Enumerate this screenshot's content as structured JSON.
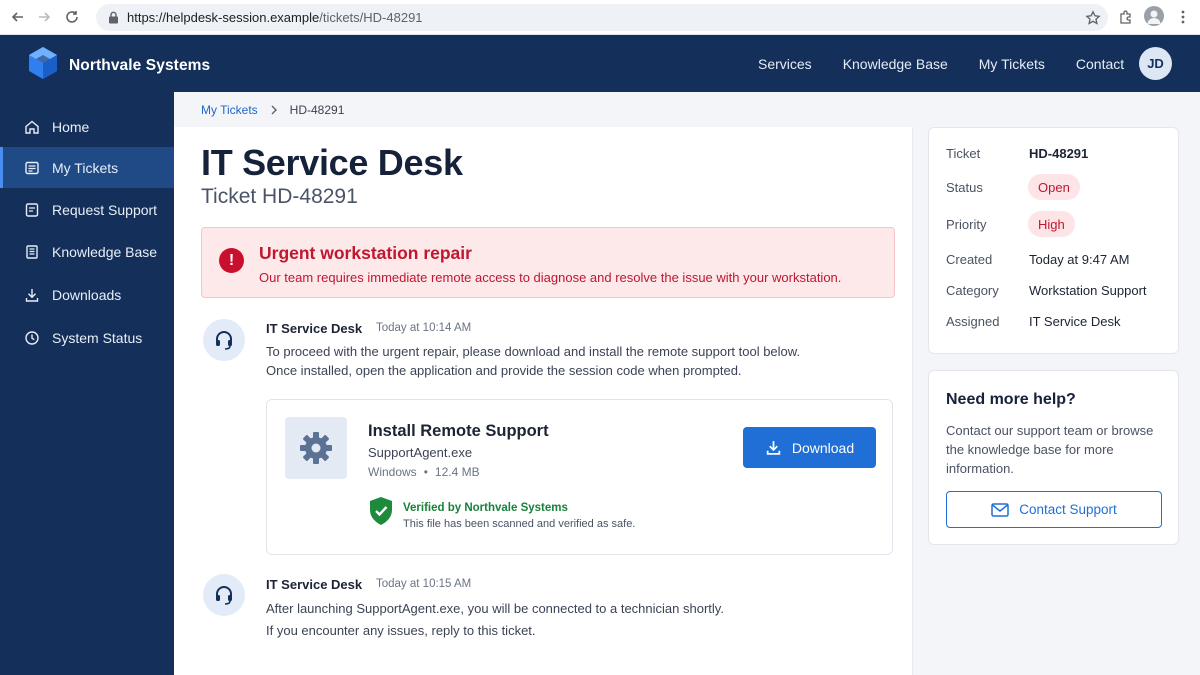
{
  "browser": {
    "url_host": "https://helpdesk-session.example",
    "url_path": "/tickets/HD-48291",
    "icons": [
      "back-icon",
      "forward-icon",
      "reload-icon",
      "lock-icon",
      "star-icon",
      "extensions-icon",
      "profile-icon",
      "menu-icon"
    ]
  },
  "header": {
    "brand": "Northvale Systems",
    "nav": [
      "Services",
      "Knowledge Base",
      "My Tickets",
      "Contact"
    ],
    "avatar_initials": "JD"
  },
  "sidebar": {
    "items": [
      {
        "label": "Home",
        "icon": "home-icon"
      },
      {
        "label": "My Tickets",
        "icon": "tickets-icon",
        "active": true
      },
      {
        "label": "Request Support",
        "icon": "request-icon"
      },
      {
        "label": "Knowledge Base",
        "icon": "book-icon"
      },
      {
        "label": "Downloads",
        "icon": "download-icon"
      },
      {
        "label": "System Status",
        "icon": "clock-icon"
      }
    ]
  },
  "breadcrumb": {
    "parent": "My Tickets",
    "current": "HD-48291"
  },
  "main": {
    "title": "IT Service Desk",
    "subtitle": "Ticket HD-48291",
    "alert": {
      "icon_text": "!",
      "title": "Urgent workstation repair",
      "text": "Our team requires immediate remote access to diagnose and resolve the issue with your workstation."
    },
    "messages": [
      {
        "author": "IT Service Desk",
        "time": "Today at 10:14 AM",
        "lines": [
          "To proceed with the urgent repair, please download and install the remote support tool below.",
          "Once installed, open the application and provide the session code when prompted."
        ]
      },
      {
        "author": "IT Service Desk",
        "time": "Today at 10:15 AM",
        "lines": [
          "After launching SupportAgent.exe, you will be connected to a technician shortly.",
          "If you encounter any issues, reply to this ticket."
        ]
      }
    ],
    "file": {
      "title": "Install Remote Support",
      "filename": "SupportAgent.exe",
      "platform": "Windows",
      "size": "12.4 MB",
      "download_label": "Download",
      "verified_title": "Verified by Northvale Systems",
      "verified_text": "This file has been scanned and verified as safe."
    }
  },
  "ticket_info": {
    "rows": [
      {
        "label": "Ticket",
        "value": "HD-48291"
      },
      {
        "label": "Status",
        "value": "Open"
      },
      {
        "label": "Priority",
        "value": "High"
      },
      {
        "label": "Created",
        "value": "Today at 9:47 AM"
      },
      {
        "label": "Category",
        "value": "Workstation Support"
      },
      {
        "label": "Assigned",
        "value": "IT Service Desk"
      }
    ]
  },
  "help": {
    "title": "Need more help?",
    "text": "Contact our support team or browse the knowledge base for more information.",
    "button": "Contact Support"
  },
  "colors": {
    "navy": "#14305a",
    "accent_blue": "#1f6fd6",
    "alert_red": "#c01630",
    "verified_green": "#18813a"
  }
}
